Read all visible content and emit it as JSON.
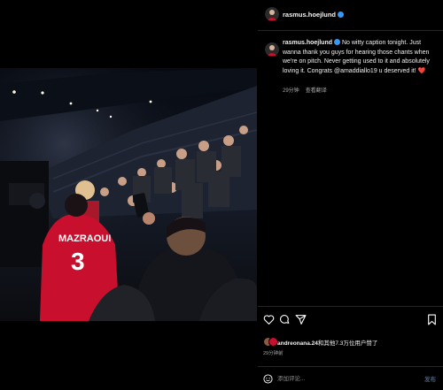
{
  "post": {
    "username": "rasmus.hoejlund",
    "caption_text": "No witty caption tonight. Just wanna thank you guys for hearing those chants when we're on pitch. Never getting used to it and absolutely loving it. Congrats @amaddiallo19 u deserved it!",
    "caption_emoji": "❤️",
    "time_ago": "29分钟",
    "see_translation": "查看翻译",
    "likes_user": "andreonana.24",
    "likes_rest": "和其他7.3万位用户赞了",
    "time_ago_footer": "29分钟前",
    "comment_placeholder": "添加评论...",
    "post_button": "发布",
    "shirt_text": "MAZRAOUI",
    "shirt_number": "3"
  },
  "icons": {
    "close": "close-icon",
    "like": "heart-icon",
    "comment": "comment-icon",
    "share": "share-icon",
    "save": "bookmark-icon",
    "emoji": "smile-icon"
  },
  "colors": {
    "verified": "#3897f0",
    "background": "#000000",
    "shirt_red": "#c8102e",
    "muted_text": "#a8a8a8"
  }
}
